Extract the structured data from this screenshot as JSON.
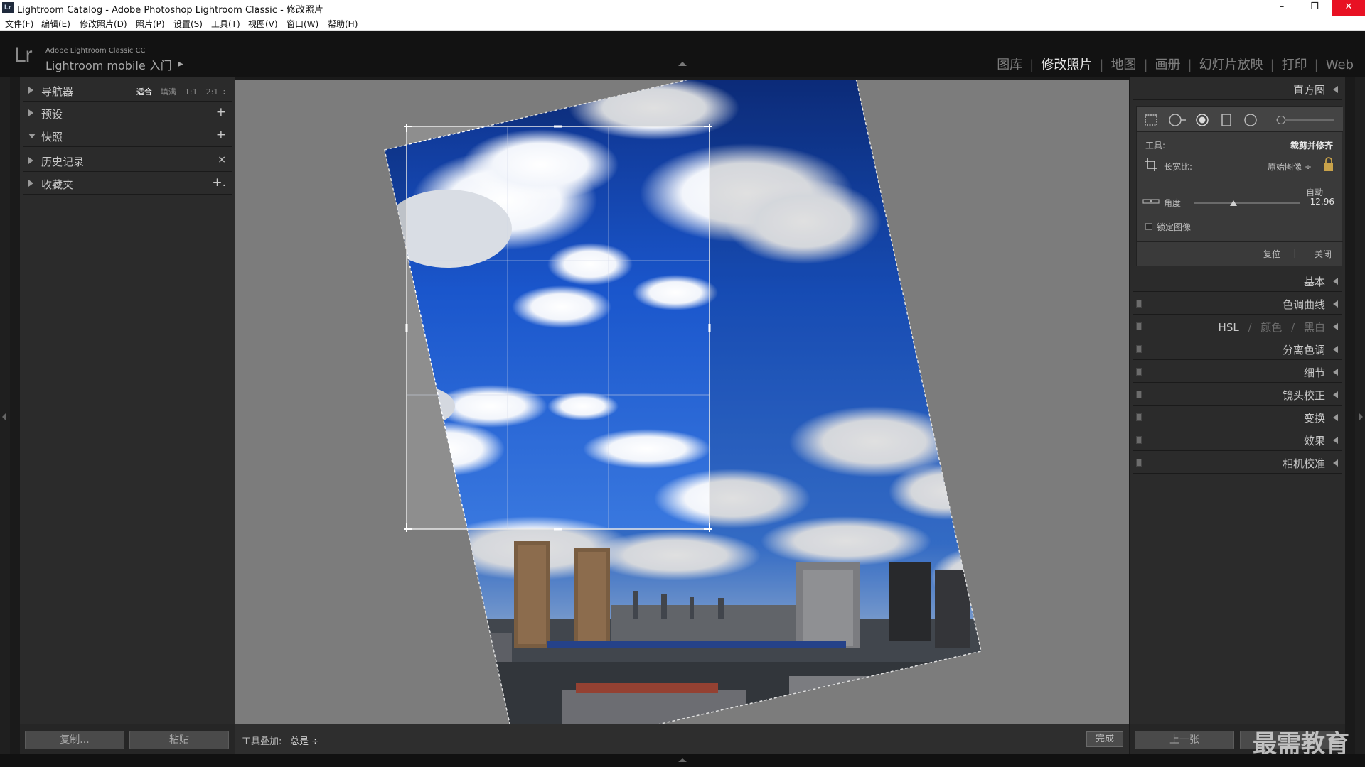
{
  "window": {
    "title": "Lightroom Catalog - Adobe Photoshop Lightroom Classic - 修改照片",
    "app_icon": "Lr",
    "controls": [
      "–",
      "❐",
      "✕"
    ]
  },
  "menu": [
    "文件(F)",
    "编辑(E)",
    "修改照片(D)",
    "照片(P)",
    "设置(S)",
    "工具(T)",
    "视图(V)",
    "窗口(W)",
    "帮助(H)"
  ],
  "header": {
    "logo": "Lr",
    "product_small": "Adobe Lightroom Classic CC",
    "product_mobile": "Lightroom mobile 入门",
    "arrow": "▶",
    "modules": [
      {
        "label": "图库",
        "active": false
      },
      {
        "label": "修改照片",
        "active": true
      },
      {
        "label": "地图",
        "active": false
      },
      {
        "label": "画册",
        "active": false
      },
      {
        "label": "幻灯片放映",
        "active": false
      },
      {
        "label": "打印",
        "active": false
      },
      {
        "label": "Web",
        "active": false
      }
    ]
  },
  "left_panel": {
    "navigator": {
      "label": "导航器",
      "zoom": [
        "适合",
        "填满",
        "1:1",
        "2:1 ÷"
      ],
      "zoom_selected": "适合"
    },
    "presets": {
      "label": "预设",
      "action": "+"
    },
    "snapshots": {
      "label": "快照",
      "action": "+"
    },
    "history": {
      "label": "历史记录",
      "action": "×"
    },
    "collections": {
      "label": "收藏夹",
      "action": "+."
    },
    "copy_button": "复制...",
    "paste_button": "粘贴"
  },
  "toolbar": {
    "overlay_label": "工具叠加:",
    "overlay_value": "总是 ÷",
    "done_button": "完成"
  },
  "crop": {
    "angle_degrees": -12.96
  },
  "right_panel": {
    "histogram": {
      "label": "直方图"
    },
    "crop_tool": {
      "tool_label": "工具:",
      "tool_name": "裁剪并修齐",
      "aspect_label": "长宽比:",
      "aspect_value": "原始图像 ÷",
      "auto_label": "自动",
      "angle_label": "角度",
      "angle_value": "– 12.96",
      "angle_fraction": 0.37,
      "lock_image_label": "锁定图像",
      "reset_button": "复位",
      "close_button": "关闭"
    },
    "sections": [
      {
        "label": "基本",
        "switch": false
      },
      {
        "label": "色调曲线",
        "switch": true
      },
      {
        "label": "HSL / 颜色 / 黑白",
        "switch": true,
        "parts": [
          "HSL",
          "颜色",
          "黑白"
        ]
      },
      {
        "label": "分离色调",
        "switch": true
      },
      {
        "label": "细节",
        "switch": true
      },
      {
        "label": "镜头校正",
        "switch": true
      },
      {
        "label": "变换",
        "switch": true
      },
      {
        "label": "效果",
        "switch": true
      },
      {
        "label": "相机校准",
        "switch": true
      }
    ],
    "prev_button": "上一张"
  },
  "watermark": "最需教育",
  "colors": {
    "panel_bg": "#2b2b2b",
    "canvas_bg": "#8e8e8e",
    "sky_top": "#0d2e86",
    "sky_mid": "#1f5fd6",
    "accent_text": "#e6e6e6"
  }
}
